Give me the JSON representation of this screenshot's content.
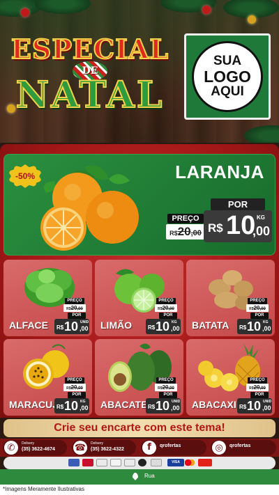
{
  "header": {
    "title_line1": "ESPECIAL",
    "title_connector": "DE",
    "title_line2": "NATAL",
    "logo": {
      "line1": "SUA",
      "line2": "LOGO",
      "line3": "AQUI"
    }
  },
  "featured": {
    "badge": "-50%",
    "name": "LARANJA",
    "old_label": "PREÇO",
    "old_currency": "R$",
    "old_integer": "20",
    "old_decimal": ",00",
    "new_label": "POR",
    "currency": "R$",
    "price_integer": "10",
    "price_decimal": ",00",
    "unit": "KG"
  },
  "products": [
    {
      "name": "ALFACE",
      "old_label": "PREÇO",
      "old_currency": "R$",
      "old_integer": "20",
      "old_decimal": ",00",
      "new_label": "POR",
      "currency": "R$",
      "price_integer": "10",
      "price_decimal": ",00",
      "unit": "UNID"
    },
    {
      "name": "LIMÃO",
      "old_label": "PREÇO",
      "old_currency": "R$",
      "old_integer": "20",
      "old_decimal": ",00",
      "new_label": "POR",
      "currency": "R$",
      "price_integer": "10",
      "price_decimal": ",00",
      "unit": "KG"
    },
    {
      "name": "BATATA",
      "old_label": "PREÇO",
      "old_currency": "R$",
      "old_integer": "20",
      "old_decimal": ",00",
      "new_label": "POR",
      "currency": "R$",
      "price_integer": "10",
      "price_decimal": ",00",
      "unit": "KG"
    },
    {
      "name": "MARACUJÁ",
      "old_label": "PREÇO",
      "old_currency": "R$",
      "old_integer": "20",
      "old_decimal": ",00",
      "new_label": "POR",
      "currency": "R$",
      "price_integer": "10",
      "price_decimal": ",00",
      "unit": "KG"
    },
    {
      "name": "ABACATE",
      "old_label": "PREÇO",
      "old_currency": "R$",
      "old_integer": "20",
      "old_decimal": ",00",
      "new_label": "POR",
      "currency": "R$",
      "price_integer": "10",
      "price_decimal": ",00",
      "unit": "UNID"
    },
    {
      "name": "ABACAXI",
      "old_label": "PREÇO",
      "old_currency": "R$",
      "old_integer": "20",
      "old_decimal": ",00",
      "new_label": "POR",
      "currency": "R$",
      "price_integer": "10",
      "price_decimal": ",00",
      "unit": "UNID"
    }
  ],
  "cta": "Crie seu encarte com este tema!",
  "contacts": {
    "whatsapp_label": "Delivery",
    "whatsapp_phone": "(35) 3622-4674",
    "phone_label": "Delivery",
    "phone_number": "(35) 3622-4322",
    "facebook": "qrofertas",
    "instagram": "qrofertas"
  },
  "payment": {
    "visa": "VISA"
  },
  "address": "Rua",
  "footer_note": "*Imagens Meramente Ilustrativas",
  "colors": {
    "accent_red": "#b01717",
    "accent_green": "#2e8b3e",
    "gold": "#f2d34a"
  }
}
